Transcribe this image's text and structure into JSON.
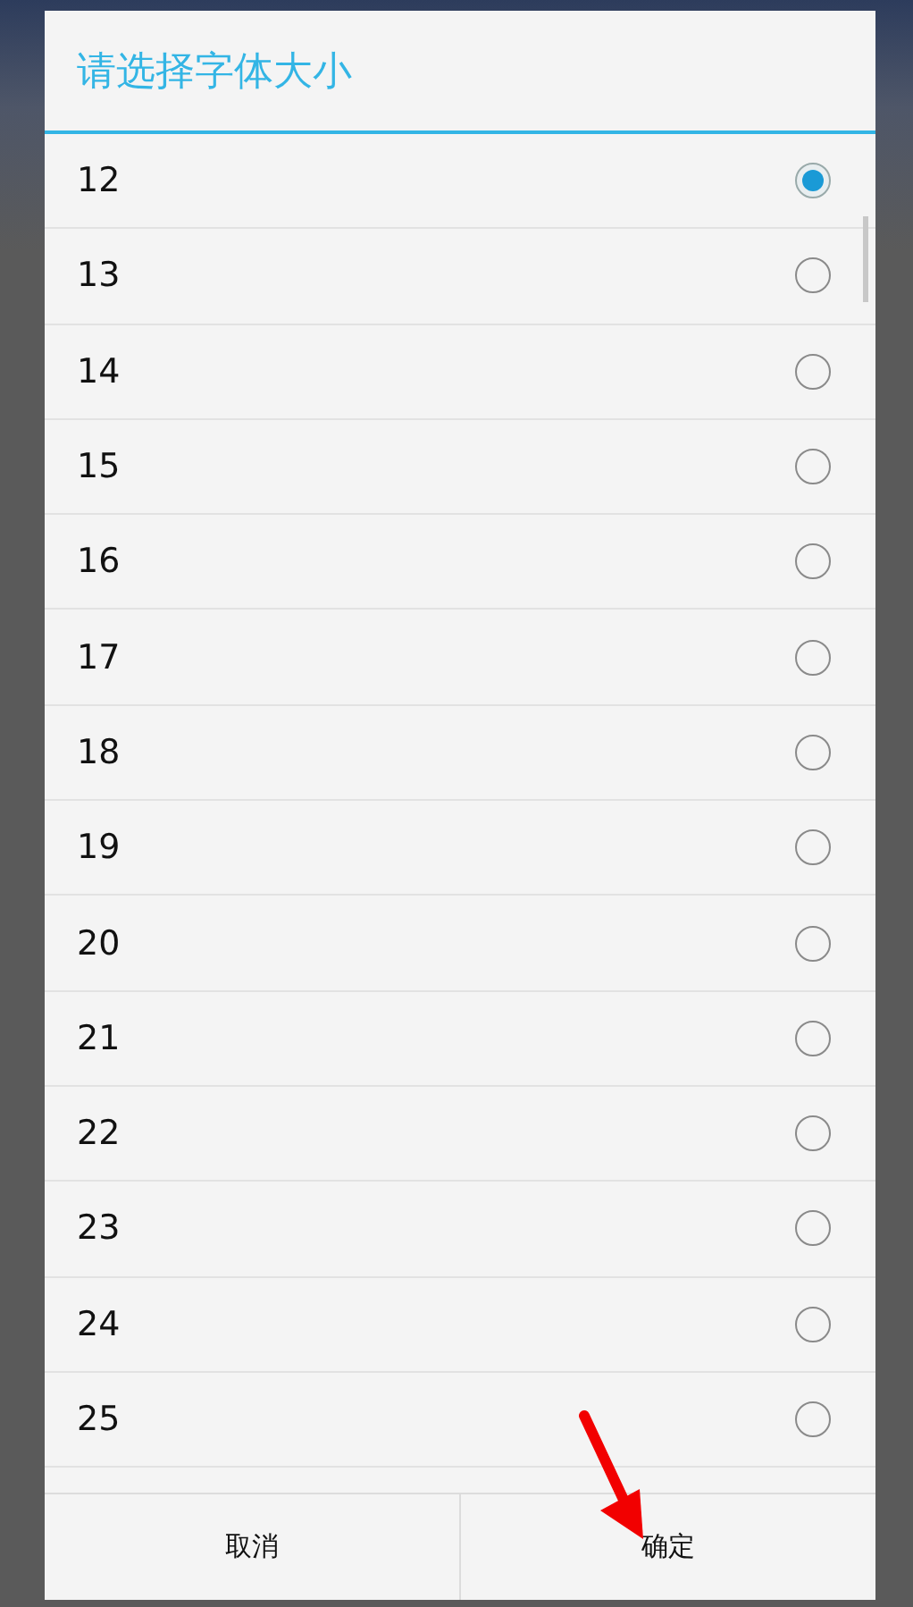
{
  "dialog": {
    "title": "请选择字体大小",
    "options": [
      {
        "label": "12",
        "selected": true
      },
      {
        "label": "13",
        "selected": false
      },
      {
        "label": "14",
        "selected": false
      },
      {
        "label": "15",
        "selected": false
      },
      {
        "label": "16",
        "selected": false
      },
      {
        "label": "17",
        "selected": false
      },
      {
        "label": "18",
        "selected": false
      },
      {
        "label": "19",
        "selected": false
      },
      {
        "label": "20",
        "selected": false
      },
      {
        "label": "21",
        "selected": false
      },
      {
        "label": "22",
        "selected": false
      },
      {
        "label": "23",
        "selected": false
      },
      {
        "label": "24",
        "selected": false
      },
      {
        "label": "25",
        "selected": false
      }
    ],
    "buttons": [
      "取消",
      "确定"
    ]
  },
  "annotations": [
    {
      "kind": "arrow"
    }
  ]
}
